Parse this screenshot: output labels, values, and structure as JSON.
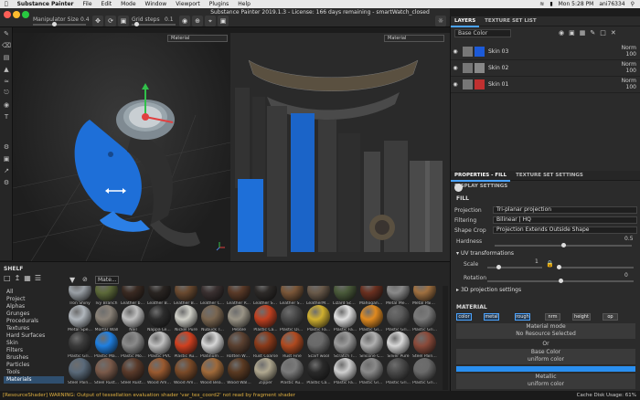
{
  "menubar": {
    "app": "Substance Painter",
    "items": [
      "File",
      "Edit",
      "Mode",
      "Window",
      "Viewport",
      "Plugins",
      "Help"
    ],
    "right": {
      "day_time": "Mon 5:28 PM",
      "user": "ani76334"
    }
  },
  "title": "Substance Painter 2019.1.3 - License: 166 days remaining - smartWatch_closed",
  "toolbar": {
    "manipulator_label": "Manipulator Size",
    "manipulator_value": "0.4",
    "manipulator_level": 0.4,
    "grid_label": "Grid steps",
    "grid_value": "0.1",
    "grid_level": 0.1
  },
  "viewport": {
    "left_select": "Material",
    "right_select": "Material"
  },
  "layers_panel": {
    "tabs": [
      "LAYERS",
      "TEXTURE SET LIST"
    ],
    "channel": "Base Color",
    "layers": [
      {
        "name": "Skin 03",
        "blend": "Norm",
        "opacity": "100"
      },
      {
        "name": "Skin 02",
        "blend": "Norm",
        "opacity": "100"
      },
      {
        "name": "Skin 01",
        "blend": "Norm",
        "opacity": "100"
      }
    ]
  },
  "properties": {
    "tabs": [
      "PROPERTIES - FILL",
      "TEXTURE SET SETTINGS",
      "DISPLAY SETTINGS"
    ],
    "fill_header": "FILL",
    "projection_label": "Projection",
    "projection_value": "Tri-planar projection",
    "filtering_label": "Filtering",
    "filtering_value": "Bilinear | HQ",
    "shape_crop_label": "Shape Crop",
    "shape_crop_value": "Projection Extends Outside Shape",
    "hardness_label": "Hardness",
    "hardness_value": "0.5",
    "hardness_level": 0.5,
    "uv_header": "UV transformations",
    "scale_label": "Scale",
    "scale_value": "1",
    "scale_level": 0.2,
    "rotation_label": "Rotation",
    "rotation_value": "0",
    "rotation_level": 0.5,
    "proj3d_header": "3D projection settings",
    "material_header": "MATERIAL",
    "channels": [
      "color",
      "metal",
      "rough",
      "nrm",
      "height",
      "op"
    ],
    "material_mode_label": "Material mode",
    "material_mode_value": "No Resource Selected",
    "or_text": "Or",
    "base_color_label": "Base Color",
    "base_color_mode": "uniform color",
    "base_color_hex": "#2a8ff0",
    "metallic_label": "Metallic",
    "metallic_mode": "uniform color"
  },
  "shelf": {
    "title": "SHELF",
    "search_value": "Mate...",
    "categories": [
      "All",
      "Project",
      "Alphas",
      "Grunges",
      "Procedurals",
      "Textures",
      "Hard Surfaces",
      "Skin",
      "Filters",
      "Brushes",
      "Particles",
      "Tools",
      "Materials"
    ],
    "selected_category": "Materials",
    "materials": [
      {
        "name": "Iron Shiny",
        "color": "#9aa0a6"
      },
      {
        "name": "Ivy Branch",
        "color": "#5d6a3a"
      },
      {
        "name": "Leather bag",
        "color": "#3a2a22"
      },
      {
        "name": "Leather Bl...",
        "color": "#2a2522"
      },
      {
        "name": "Leather Bl...",
        "color": "#6a4a30"
      },
      {
        "name": "Leather Cl...",
        "color": "#3a3030"
      },
      {
        "name": "Leather Ro...",
        "color": "#5a3a28"
      },
      {
        "name": "Leather Sa...",
        "color": "#2d2a28"
      },
      {
        "name": "Leather Sa...",
        "color": "#7a5638"
      },
      {
        "name": "LeatherMet...",
        "color": "#6a5a4a"
      },
      {
        "name": "Lizard Sca...",
        "color": "#4a5a3a"
      },
      {
        "name": "Mahogany...",
        "color": "#6a3020"
      },
      {
        "name": "Metal Mes...",
        "color": "#8a8a8a"
      },
      {
        "name": "Metal Pain...",
        "color": "#a07040"
      },
      {
        "name": "Metal Spe...",
        "color": "#b0b6bc"
      },
      {
        "name": "Mortar Wall",
        "color": "#8a8278"
      },
      {
        "name": "Nail",
        "color": "#c0c0c0"
      },
      {
        "name": "Nappa Lea...",
        "color": "#2c2c2c"
      },
      {
        "name": "Nickel Pure",
        "color": "#d0d0c8"
      },
      {
        "name": "Nubuck T...",
        "color": "#7a6650"
      },
      {
        "name": "Pebble",
        "color": "#9a9486"
      },
      {
        "name": "Plastic Ca...",
        "color": "#c04020"
      },
      {
        "name": "Plastic Dia...",
        "color": "#4a4a4a"
      },
      {
        "name": "Plastic Fa...",
        "color": "#d0b030"
      },
      {
        "name": "Plastic Fa...",
        "color": "#e0e0e0"
      },
      {
        "name": "Plastic Gla...",
        "color": "#e08a20"
      },
      {
        "name": "Plastic Gri...",
        "color": "#5a5a5a"
      },
      {
        "name": "Plastic Gri...",
        "color": "#7a7a7a"
      },
      {
        "name": "Plastic Gri...",
        "color": "#3a3a3a"
      },
      {
        "name": "Plastic Ma...",
        "color": "#1f7fe0"
      },
      {
        "name": "Plastic Mo...",
        "color": "#8a8a8a"
      },
      {
        "name": "Plastic PVC",
        "color": "#c0c0c0"
      },
      {
        "name": "Plastic Ru...",
        "color": "#d04020"
      },
      {
        "name": "Platinum P...",
        "color": "#d6d6d6"
      },
      {
        "name": "Rotten Wo...",
        "color": "#5a4030"
      },
      {
        "name": "Rust Coarse",
        "color": "#8a3a1a"
      },
      {
        "name": "Rust Fine",
        "color": "#b04a20"
      },
      {
        "name": "Scarf wool",
        "color": "#6a6a6a"
      },
      {
        "name": "Scratch T...",
        "color": "#9a9a9a"
      },
      {
        "name": "Silicone C...",
        "color": "#b0b0b0"
      },
      {
        "name": "Silver Pure",
        "color": "#d8d8d8"
      },
      {
        "name": "Steel Paint...",
        "color": "#8a4a3a"
      },
      {
        "name": "Steel Paint...",
        "color": "#5a6a7a"
      },
      {
        "name": "Steel Rust...",
        "color": "#7a5a4a"
      },
      {
        "name": "Steel Rust...",
        "color": "#5a3a2a"
      },
      {
        "name": "Wood Ame...",
        "color": "#9a5a30"
      },
      {
        "name": "Wood Ame...",
        "color": "#7a4a28"
      },
      {
        "name": "Wood Bea...",
        "color": "#a06a3a"
      },
      {
        "name": "Wood Wal...",
        "color": "#5a3a22"
      },
      {
        "name": "Zipper",
        "color": "#b0a890"
      },
      {
        "name": "Plastic Ru...",
        "color": "#7a7a7a"
      },
      {
        "name": "Plastic Ca...",
        "color": "#2a2a2a"
      },
      {
        "name": "Plastic Fa...",
        "color": "#cfcfcf"
      },
      {
        "name": "Plastic Gla...",
        "color": "#8a8a8a"
      },
      {
        "name": "Plastic Gri...",
        "color": "#4a4a4a"
      },
      {
        "name": "Plastic Gri...",
        "color": "#6a6a6a"
      }
    ]
  },
  "status": {
    "message": "[ResourceShader] WARNING: Output of tessellation evaluation shader 'var_tex_coord2' not read by fragment shader",
    "cache_label": "Cache Disk Usage:",
    "cache_value": "61%"
  }
}
